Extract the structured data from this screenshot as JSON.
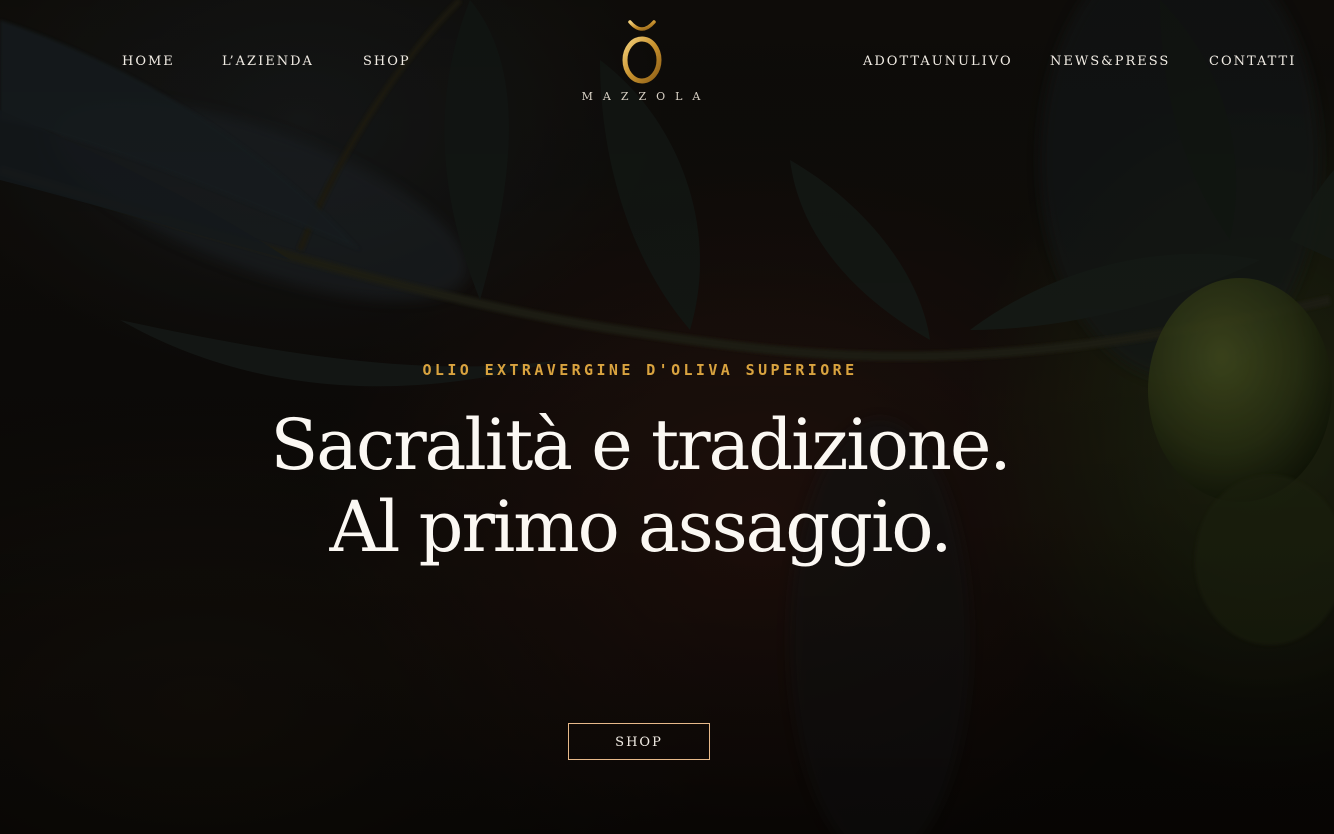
{
  "nav": {
    "left": [
      {
        "label": "HOME"
      },
      {
        "label": "L’AZIENDA"
      },
      {
        "label": "SHOP"
      }
    ],
    "right": [
      {
        "label": "ADOTTAUNULIVO"
      },
      {
        "label": "NEWS&PRESS"
      },
      {
        "label": "CONTATTI"
      }
    ]
  },
  "logo": {
    "mark": "Ŏ",
    "wordmark": "MAZZOLA",
    "icon": "olive-o-logo-icon"
  },
  "hero": {
    "eyebrow": "OLIO EXTRAVERGINE D'OLIVA SUPERIORE",
    "headline_line1": "Sacralità e tradizione.",
    "headline_line2": "Al primo assaggio.",
    "cta_label": "SHOP"
  },
  "colors": {
    "accent_gold": "#d9a33f",
    "cta_border": "#e7b98a",
    "text_light": "#f1ece4",
    "background": "#120f0c"
  }
}
